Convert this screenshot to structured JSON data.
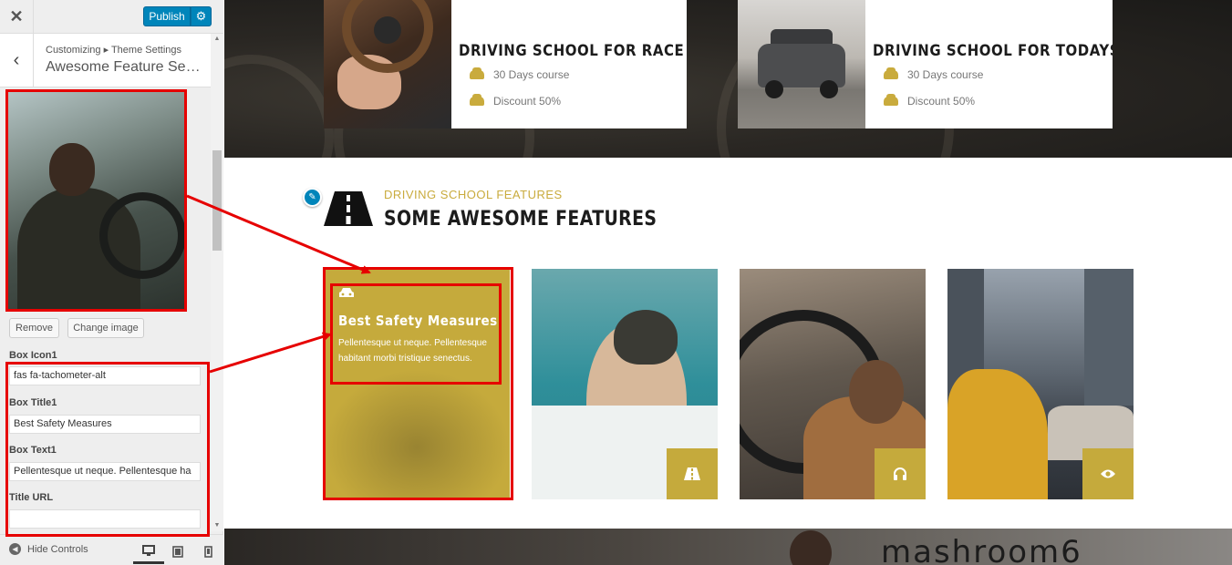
{
  "sidebar": {
    "close_icon": "close-icon",
    "publish_label": "Publish",
    "publish_settings_icon": "gear-icon",
    "back_icon": "chevron-left-icon",
    "breadcrumb": "Customizing ▸ Theme Settings",
    "section_title": "Awesome Feature Se…",
    "image_buttons": {
      "remove": "Remove",
      "change": "Change image"
    },
    "fields": [
      {
        "label": "Box Icon1",
        "value": "fas fa-tachometer-alt"
      },
      {
        "label": "Box Title1",
        "value": "Best Safety Measures"
      },
      {
        "label": "Box Text1",
        "value": "Pellentesque ut neque. Pellentesque ha"
      },
      {
        "label": "Title URL",
        "value": ""
      }
    ],
    "footer": {
      "hide_controls": "Hide Controls",
      "devices": [
        "desktop",
        "tablet",
        "mobile"
      ],
      "active_device": "desktop"
    }
  },
  "preview": {
    "top_cards": [
      {
        "title": "DRIVING SCHOOL FOR RACE CARS",
        "lines": [
          "30 Days course",
          "Discount 50%"
        ]
      },
      {
        "title": "DRIVING SCHOOL FOR TODAYS TEEN",
        "lines": [
          "30 Days course",
          "Discount 50%"
        ]
      }
    ],
    "section": {
      "subtitle": "DRIVING SCHOOL FEATURES",
      "title": "SOME AWESOME FEATURES",
      "icon": "road-icon"
    },
    "features": [
      {
        "title": "Best Safety Measures",
        "text": "Pellentesque ut neque. Pellentesque habitant morbi tristique senectus.",
        "icon": "car-icon"
      },
      {
        "icon": "road-icon"
      },
      {
        "icon": "headphones-icon"
      },
      {
        "icon": "eye-icon"
      }
    ],
    "bottom_text": "mashroom6"
  },
  "colors": {
    "accent": "#c5aa3c",
    "publish": "#0085ba",
    "annotation": "#e60000"
  }
}
